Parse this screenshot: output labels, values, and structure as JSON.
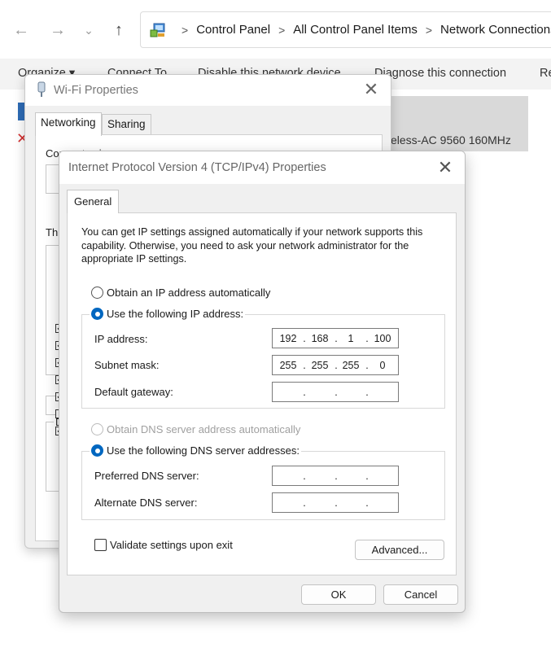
{
  "explorer": {
    "breadcrumb": [
      "Control Panel",
      "All Control Panel Items",
      "Network Connections"
    ],
    "breadcrumb_sep": ">",
    "commands": [
      "Organize ▾",
      "Connect To",
      "Disable this network device",
      "Diagnose this connection",
      "Re"
    ],
    "network_item_text": "eless-AC 9560 160MHz"
  },
  "wifi_dialog": {
    "title": "Wi-Fi Properties",
    "tabs": [
      "Networking",
      "Sharing"
    ],
    "connect_using_fragment": "Connect using:",
    "this_fragment": "Thi",
    "d_fragment": "D"
  },
  "ipv4_dialog": {
    "title": "Internet Protocol Version 4 (TCP/IPv4) Properties",
    "tab": "General",
    "description": "You can get IP settings assigned automatically if your network supports this capability. Otherwise, you need to ask your network administrator for the appropriate IP settings.",
    "ip_auto_label": "Obtain an IP address automatically",
    "ip_manual_label": "Use the following IP address:",
    "ip_address_label": "IP address:",
    "ip_address": [
      "192",
      "168",
      "1",
      "100"
    ],
    "subnet_label": "Subnet mask:",
    "subnet_mask": [
      "255",
      "255",
      "255",
      "0"
    ],
    "gateway_label": "Default gateway:",
    "gateway": [
      "",
      "",
      "",
      ""
    ],
    "dns_auto_label": "Obtain DNS server address automatically",
    "dns_manual_label": "Use the following DNS server addresses:",
    "preferred_dns_label": "Preferred DNS server:",
    "preferred_dns": [
      "",
      "",
      "",
      ""
    ],
    "alternate_dns_label": "Alternate DNS server:",
    "alternate_dns": [
      "",
      "",
      "",
      ""
    ],
    "validate_label": "Validate settings upon exit",
    "advanced_button": "Advanced...",
    "ok_button": "OK",
    "cancel_button": "Cancel"
  },
  "colors": {
    "accent": "#0067c0",
    "dialog_bg": "#f0f0f0",
    "panel_bg": "#ffffff",
    "disabled_text": "#a0a0a0"
  }
}
